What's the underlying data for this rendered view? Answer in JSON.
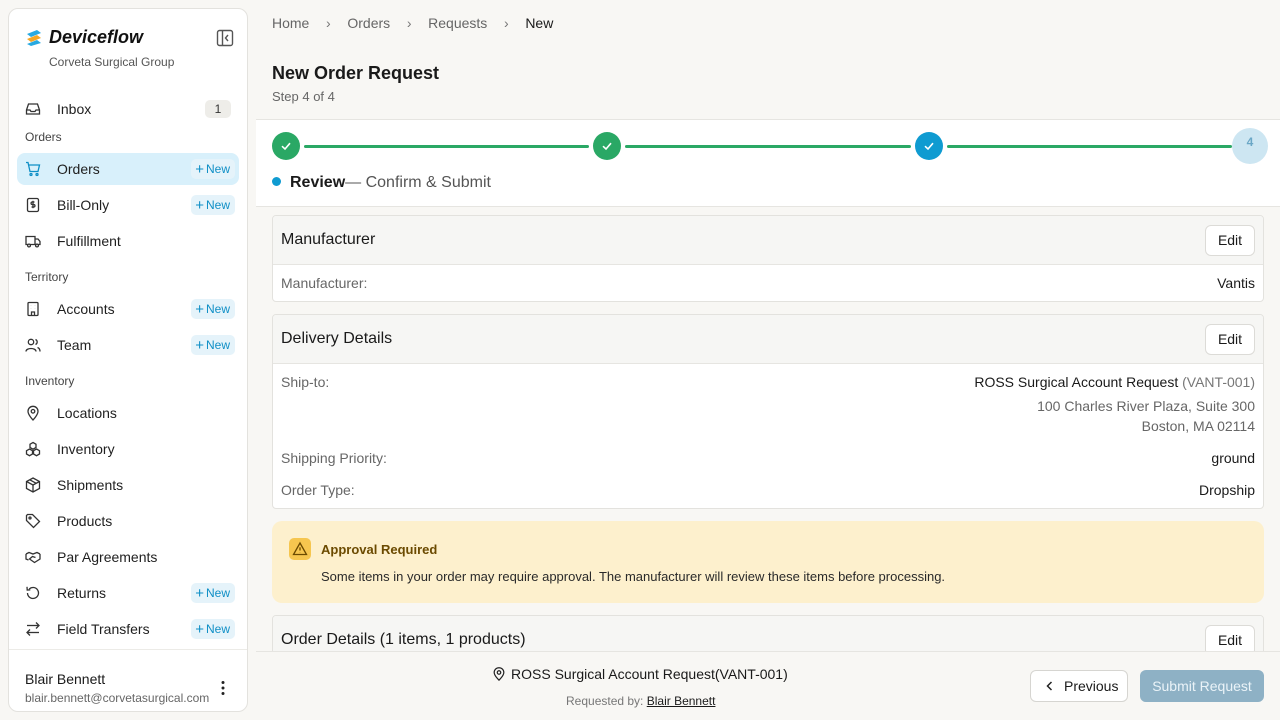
{
  "brand": {
    "name": "Deviceflow",
    "org": "Corveta Surgical Group"
  },
  "sidebar": {
    "inbox": {
      "label": "Inbox",
      "count": "1"
    },
    "sections": {
      "orders": "Orders",
      "territory": "Territory",
      "inventory": "Inventory"
    },
    "new_label": "New",
    "items": {
      "orders": "Orders",
      "bill_only": "Bill-Only",
      "fulfillment": "Fulfillment",
      "accounts": "Accounts",
      "team": "Team",
      "locations": "Locations",
      "inventory": "Inventory",
      "shipments": "Shipments",
      "products": "Products",
      "par_agreements": "Par Agreements",
      "returns": "Returns",
      "field_transfers": "Field Transfers"
    },
    "user": {
      "name": "Blair Bennett",
      "email": "blair.bennett@corvetasurgical.com"
    }
  },
  "breadcrumb": [
    "Home",
    "Orders",
    "Requests",
    "New"
  ],
  "page": {
    "title": "New Order Request",
    "step": "Step 4 of 4"
  },
  "stepper": {
    "pending_number": "4",
    "current_title": "Review",
    "current_desc": "— Confirm & Submit"
  },
  "edit_label": "Edit",
  "manufacturer_card": {
    "title": "Manufacturer",
    "label": "Manufacturer:",
    "value": "Vantis"
  },
  "delivery_card": {
    "title": "Delivery Details",
    "ship_to_label": "Ship-to:",
    "ship_to_name": "ROSS Surgical Account Request",
    "ship_to_code": "(VANT-001)",
    "address_line1": "100 Charles River Plaza, Suite 300",
    "address_line2": "Boston, MA 02114",
    "priority_label": "Shipping Priority:",
    "priority_value": "ground",
    "order_type_label": "Order Type:",
    "order_type_value": "Dropship"
  },
  "alert": {
    "title": "Approval Required",
    "text": "Some items in your order may require approval. The manufacturer will review these items before processing."
  },
  "order_details_card": {
    "title": "Order Details (1 items, 1 products)"
  },
  "footer": {
    "account": "ROSS Surgical Account Request(VANT-001)",
    "requested_by_label": "Requested by:",
    "requested_by_name": "Blair Bennett",
    "previous_label": "Previous",
    "submit_label": "Submit Request"
  },
  "colors": {
    "accent": "#0f9bd1",
    "success": "#2aa865",
    "alert_bg": "#fdf0cd",
    "submit_disabled": "#8eb1c5"
  }
}
